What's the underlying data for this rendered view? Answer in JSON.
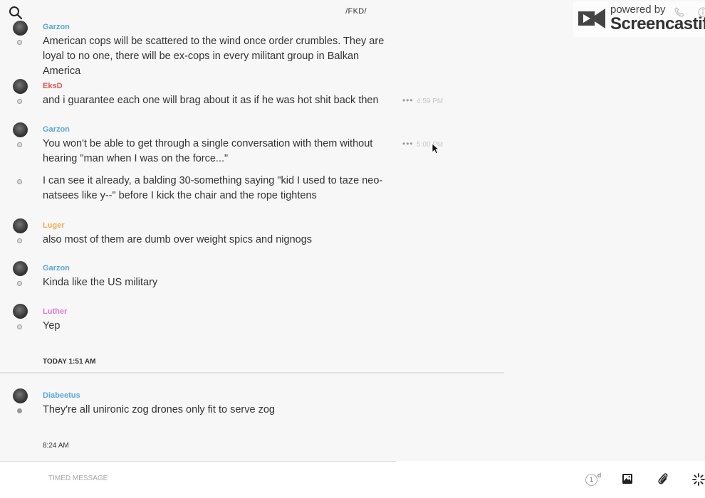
{
  "header": {
    "title": "/FKD/"
  },
  "watermark": {
    "line1": "powered by",
    "line2": "Screencastify"
  },
  "messages": [
    {
      "author": "Garzon",
      "author_color": "#5aa7d6",
      "text": "American cops will be scattered to the wind once order crumbles. They are loyal to no one, there will be ex-cops in every militant group in Balkan America"
    },
    {
      "author": "EksD",
      "author_color": "#d9534f",
      "text": "and i guarantee each one will brag about it as if he was hot shit back then",
      "time": "4:59 PM"
    },
    {
      "author": "Garzon",
      "author_color": "#5aa7d6",
      "text": "You won't be able to get through a single conversation with them without hearing \"man when I was on the force...\"",
      "time": "5:00 PM"
    },
    {
      "author": "",
      "text": "I can see it already, a balding 30-something saying \"kid I used to taze neo-natsees like y--\" before I kick the chair and the rope tightens"
    },
    {
      "author": "Luger",
      "author_color": "#f0ad4e",
      "text": "also most of them are dumb over weight spics and nignogs"
    },
    {
      "author": "Garzon",
      "author_color": "#5aa7d6",
      "text": "Kinda like the US military"
    },
    {
      "author": "Luther",
      "author_color": "#e07ccf",
      "text": "Yep"
    },
    {
      "author": "Diabeetus",
      "author_color": "#5aa7d6",
      "text": "They're all unironic zog drones only fit to serve zog"
    }
  ],
  "separators": {
    "today": "TODAY 1:51 AM",
    "later": "8:24 AM"
  },
  "composer": {
    "placeholder": "TIMED MESSAGE",
    "timer_value": "1",
    "timer_unit": "d"
  },
  "icons": {
    "search": "search-icon",
    "phone": "phone-icon",
    "info": "info-icon",
    "timer": "timer-icon",
    "image": "image-icon",
    "attach": "paperclip-icon",
    "spark": "sparkle-icon"
  }
}
